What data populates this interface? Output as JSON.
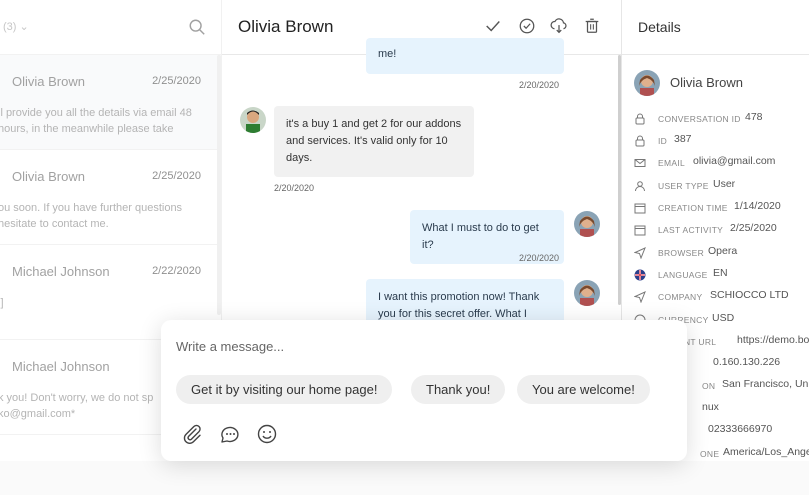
{
  "left": {
    "filter_label": "(3)",
    "conversations": [
      {
        "name": "Olivia Brown",
        "date": "2/25/2020",
        "snippet": "ll provide you all the details via email 48 hours, in the meanwhile please take"
      },
      {
        "name": "Olivia Brown",
        "date": "2/25/2020",
        "snippet": "ou soon. If you have further questions hesitate to contact me."
      },
      {
        "name": "Michael Johnson",
        "date": "2/22/2020",
        "snippet": "l]"
      },
      {
        "name": "Michael Johnson",
        "date": "",
        "snippet": "k you! Don't worry, we do not sp ko@gmail.com*"
      }
    ]
  },
  "chat": {
    "title": "Olivia Brown",
    "messages": [
      {
        "text": "me!",
        "date": "2/20/2020"
      },
      {
        "text": "it's a buy 1 and get 2 for our addons and services. It's valid only for 10 days.",
        "date": "2/20/2020"
      },
      {
        "text": "What I must to do to get it?",
        "date": "2/20/2020"
      },
      {
        "text": "I want this promotion now! Thank you  for this secret offer. What I",
        "date": ""
      }
    ]
  },
  "details": {
    "title": "Details",
    "user_name": "Olivia Brown",
    "rows": [
      {
        "label": "CONVERSATION ID",
        "value": "478",
        "icon": "lock-icon"
      },
      {
        "label": "ID",
        "value": "387",
        "icon": "lock-icon"
      },
      {
        "label": "EMAIL",
        "value": "olivia@gmail.com",
        "icon": "mail-icon"
      },
      {
        "label": "USER TYPE",
        "value": "User",
        "icon": "user-icon"
      },
      {
        "label": "CREATION TIME",
        "value": "1/14/2020",
        "icon": "calendar-icon"
      },
      {
        "label": "LAST ACTIVITY",
        "value": "2/25/2020",
        "icon": "calendar-icon"
      },
      {
        "label": "BROWSER",
        "value": "Opera",
        "icon": "send-icon"
      },
      {
        "label": "LANGUAGE",
        "value": "EN",
        "icon": "flag-icon"
      },
      {
        "label": "COMPANY",
        "value": "SCHIOCCO LTD",
        "icon": "send-icon"
      },
      {
        "label": "CURRENCY",
        "value": "USD",
        "icon": "currency-icon"
      },
      {
        "label": "ENT URL",
        "value": "https://demo.boa",
        "icon": "link-icon"
      },
      {
        "label": "",
        "value": "0.160.130.226",
        "icon": ""
      },
      {
        "label": "ON",
        "value": "San Francisco, Unite",
        "icon": ""
      },
      {
        "label": "",
        "value": "nux",
        "icon": ""
      },
      {
        "label": "",
        "value": "02333666970",
        "icon": ""
      },
      {
        "label": "ONE",
        "value": "America/Los_Angele",
        "icon": ""
      }
    ]
  },
  "composer": {
    "placeholder": "Write a message...",
    "quick_replies": [
      "Get it by visiting our home page!",
      "Thank you!",
      "You are welcome!"
    ]
  }
}
